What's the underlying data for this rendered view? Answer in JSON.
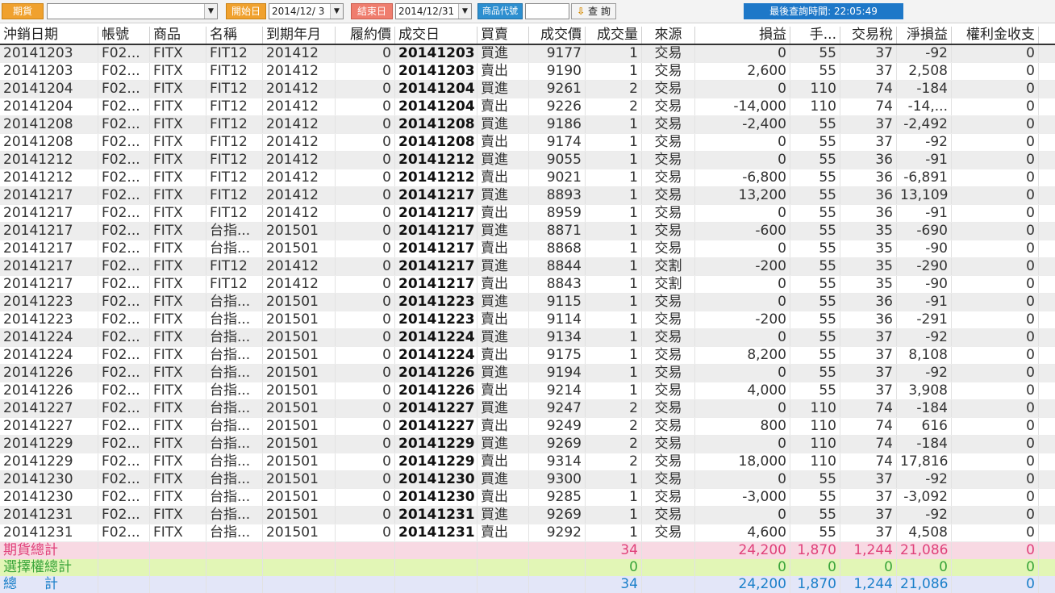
{
  "toolbar": {
    "market_label": "期貨",
    "market_value": "",
    "start_label": "開始日",
    "start_value": "2014/12/ 3",
    "end_label": "結束日",
    "end_value": "2014/12/31",
    "product_label": "商品代號",
    "product_value": "",
    "query_label": "查 詢",
    "last_query": "最後查詢時間: 22:05:49"
  },
  "columns": [
    "沖銷日期",
    "帳號",
    "商品",
    "名稱",
    "到期年月",
    "履約價",
    "成交日",
    "買賣",
    "成交價",
    "成交量",
    "來源",
    "損益",
    "手...",
    "交易稅",
    "淨損益",
    "權利金收支"
  ],
  "rows": [
    [
      "20141203",
      "F02...",
      "FITX",
      "FIT12",
      "201412",
      "0",
      "20141203",
      "買進",
      "9177",
      "1",
      "交易",
      "0",
      "55",
      "37",
      "-92",
      "0"
    ],
    [
      "20141203",
      "F02...",
      "FITX",
      "FIT12",
      "201412",
      "0",
      "20141203",
      "賣出",
      "9190",
      "1",
      "交易",
      "2,600",
      "55",
      "37",
      "2,508",
      "0"
    ],
    [
      "20141204",
      "F02...",
      "FITX",
      "FIT12",
      "201412",
      "0",
      "20141204",
      "買進",
      "9261",
      "2",
      "交易",
      "0",
      "110",
      "74",
      "-184",
      "0"
    ],
    [
      "20141204",
      "F02...",
      "FITX",
      "FIT12",
      "201412",
      "0",
      "20141204",
      "賣出",
      "9226",
      "2",
      "交易",
      "-14,000",
      "110",
      "74",
      "-14,...",
      "0"
    ],
    [
      "20141208",
      "F02...",
      "FITX",
      "FIT12",
      "201412",
      "0",
      "20141208",
      "買進",
      "9186",
      "1",
      "交易",
      "-2,400",
      "55",
      "37",
      "-2,492",
      "0"
    ],
    [
      "20141208",
      "F02...",
      "FITX",
      "FIT12",
      "201412",
      "0",
      "20141208",
      "賣出",
      "9174",
      "1",
      "交易",
      "0",
      "55",
      "37",
      "-92",
      "0"
    ],
    [
      "20141212",
      "F02...",
      "FITX",
      "FIT12",
      "201412",
      "0",
      "20141212",
      "買進",
      "9055",
      "1",
      "交易",
      "0",
      "55",
      "36",
      "-91",
      "0"
    ],
    [
      "20141212",
      "F02...",
      "FITX",
      "FIT12",
      "201412",
      "0",
      "20141212",
      "賣出",
      "9021",
      "1",
      "交易",
      "-6,800",
      "55",
      "36",
      "-6,891",
      "0"
    ],
    [
      "20141217",
      "F02...",
      "FITX",
      "FIT12",
      "201412",
      "0",
      "20141217",
      "買進",
      "8893",
      "1",
      "交易",
      "13,200",
      "55",
      "36",
      "13,109",
      "0"
    ],
    [
      "20141217",
      "F02...",
      "FITX",
      "FIT12",
      "201412",
      "0",
      "20141217",
      "賣出",
      "8959",
      "1",
      "交易",
      "0",
      "55",
      "36",
      "-91",
      "0"
    ],
    [
      "20141217",
      "F02...",
      "FITX",
      "台指...",
      "201501",
      "0",
      "20141217",
      "買進",
      "8871",
      "1",
      "交易",
      "-600",
      "55",
      "35",
      "-690",
      "0"
    ],
    [
      "20141217",
      "F02...",
      "FITX",
      "台指...",
      "201501",
      "0",
      "20141217",
      "賣出",
      "8868",
      "1",
      "交易",
      "0",
      "55",
      "35",
      "-90",
      "0"
    ],
    [
      "20141217",
      "F02...",
      "FITX",
      "FIT12",
      "201412",
      "0",
      "20141217",
      "買進",
      "8844",
      "1",
      "交割",
      "-200",
      "55",
      "35",
      "-290",
      "0"
    ],
    [
      "20141217",
      "F02...",
      "FITX",
      "FIT12",
      "201412",
      "0",
      "20141217",
      "賣出",
      "8843",
      "1",
      "交割",
      "0",
      "55",
      "35",
      "-90",
      "0"
    ],
    [
      "20141223",
      "F02...",
      "FITX",
      "台指...",
      "201501",
      "0",
      "20141223",
      "買進",
      "9115",
      "1",
      "交易",
      "0",
      "55",
      "36",
      "-91",
      "0"
    ],
    [
      "20141223",
      "F02...",
      "FITX",
      "台指...",
      "201501",
      "0",
      "20141223",
      "賣出",
      "9114",
      "1",
      "交易",
      "-200",
      "55",
      "36",
      "-291",
      "0"
    ],
    [
      "20141224",
      "F02...",
      "FITX",
      "台指...",
      "201501",
      "0",
      "20141224",
      "買進",
      "9134",
      "1",
      "交易",
      "0",
      "55",
      "37",
      "-92",
      "0"
    ],
    [
      "20141224",
      "F02...",
      "FITX",
      "台指...",
      "201501",
      "0",
      "20141224",
      "賣出",
      "9175",
      "1",
      "交易",
      "8,200",
      "55",
      "37",
      "8,108",
      "0"
    ],
    [
      "20141226",
      "F02...",
      "FITX",
      "台指...",
      "201501",
      "0",
      "20141226",
      "買進",
      "9194",
      "1",
      "交易",
      "0",
      "55",
      "37",
      "-92",
      "0"
    ],
    [
      "20141226",
      "F02...",
      "FITX",
      "台指...",
      "201501",
      "0",
      "20141226",
      "賣出",
      "9214",
      "1",
      "交易",
      "4,000",
      "55",
      "37",
      "3,908",
      "0"
    ],
    [
      "20141227",
      "F02...",
      "FITX",
      "台指...",
      "201501",
      "0",
      "20141227",
      "買進",
      "9247",
      "2",
      "交易",
      "0",
      "110",
      "74",
      "-184",
      "0"
    ],
    [
      "20141227",
      "F02...",
      "FITX",
      "台指...",
      "201501",
      "0",
      "20141227",
      "賣出",
      "9249",
      "2",
      "交易",
      "800",
      "110",
      "74",
      "616",
      "0"
    ],
    [
      "20141229",
      "F02...",
      "FITX",
      "台指...",
      "201501",
      "0",
      "20141229",
      "買進",
      "9269",
      "2",
      "交易",
      "0",
      "110",
      "74",
      "-184",
      "0"
    ],
    [
      "20141229",
      "F02...",
      "FITX",
      "台指...",
      "201501",
      "0",
      "20141229",
      "賣出",
      "9314",
      "2",
      "交易",
      "18,000",
      "110",
      "74",
      "17,816",
      "0"
    ],
    [
      "20141230",
      "F02...",
      "FITX",
      "台指...",
      "201501",
      "0",
      "20141230",
      "買進",
      "9300",
      "1",
      "交易",
      "0",
      "55",
      "37",
      "-92",
      "0"
    ],
    [
      "20141230",
      "F02...",
      "FITX",
      "台指...",
      "201501",
      "0",
      "20141230",
      "賣出",
      "9285",
      "1",
      "交易",
      "-3,000",
      "55",
      "37",
      "-3,092",
      "0"
    ],
    [
      "20141231",
      "F02...",
      "FITX",
      "台指...",
      "201501",
      "0",
      "20141231",
      "買進",
      "9269",
      "1",
      "交易",
      "0",
      "55",
      "37",
      "-92",
      "0"
    ],
    [
      "20141231",
      "F02...",
      "FITX",
      "台指...",
      "201501",
      "0",
      "20141231",
      "賣出",
      "9292",
      "1",
      "交易",
      "4,600",
      "55",
      "37",
      "4,508",
      "0"
    ]
  ],
  "summary": {
    "futures": {
      "label": "期貨總計",
      "qty": "34",
      "pl": "24,200",
      "fee": "1,870",
      "tax": "1,244",
      "net": "21,086",
      "premium": "0"
    },
    "options": {
      "label": "選擇權總計",
      "qty": "0",
      "pl": "0",
      "fee": "0",
      "tax": "0",
      "net": "0",
      "premium": "0"
    },
    "total": {
      "label": "總　　計",
      "qty": "34",
      "pl": "24,200",
      "fee": "1,870",
      "tax": "1,244",
      "net": "21,086",
      "premium": "0"
    }
  },
  "colors": {
    "futures_total": "#e0407a",
    "options_total": "#3aa53a",
    "grand_total": "#1a7fc9"
  }
}
